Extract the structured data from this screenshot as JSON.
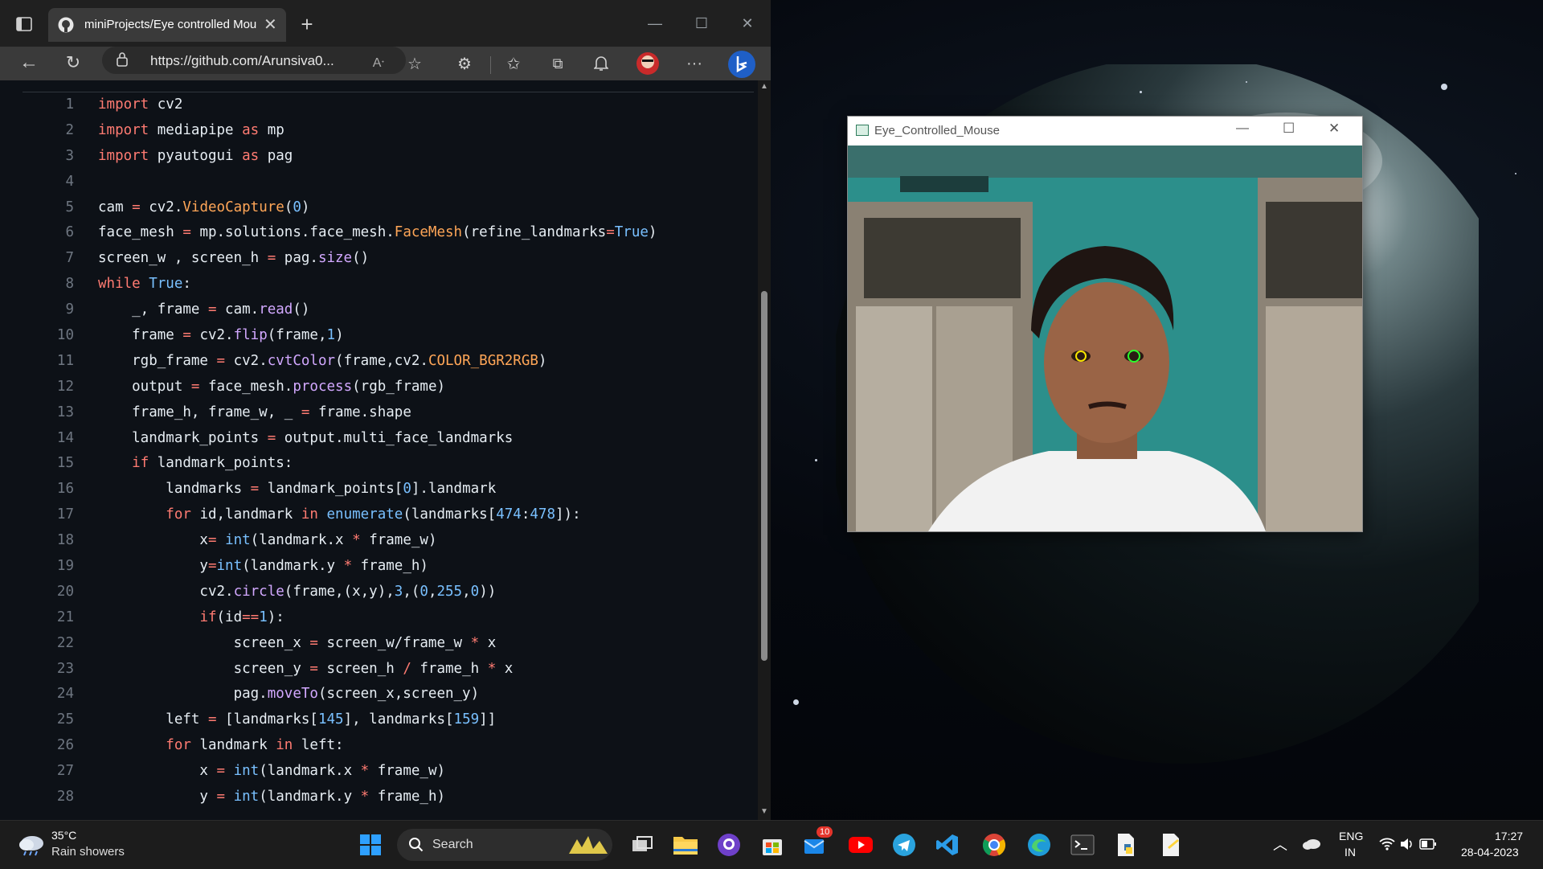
{
  "browser": {
    "tab_title": "miniProjects/Eye controlled Mou",
    "url": "https://github.com/Arunsiva0...",
    "code_lines": [
      {
        "n": "1",
        "html": "<span class='k'>import</span> cv2"
      },
      {
        "n": "2",
        "html": "<span class='k'>import</span> mediapipe <span class='k'>as</span> mp"
      },
      {
        "n": "3",
        "html": "<span class='k'>import</span> pyautogui <span class='k'>as</span> pag"
      },
      {
        "n": "4",
        "html": ""
      },
      {
        "n": "5",
        "html": "cam <span class='k'>=</span> cv2.<span class='c'>VideoCapture</span>(<span class='n'>0</span>)"
      },
      {
        "n": "6",
        "html": "face_mesh <span class='k'>=</span> mp.solutions.face_mesh.<span class='c'>FaceMesh</span>(refine_landmarks<span class='k'>=</span><span class='n'>True</span>)"
      },
      {
        "n": "7",
        "html": "screen_w , screen_h <span class='k'>=</span> pag.<span class='f'>size</span>()"
      },
      {
        "n": "8",
        "html": "<span class='k'>while</span> <span class='n'>True</span>:"
      },
      {
        "n": "9",
        "html": "    _, frame <span class='k'>=</span> cam.<span class='f'>read</span>()"
      },
      {
        "n": "10",
        "html": "    frame <span class='k'>=</span> cv2.<span class='f'>flip</span>(frame,<span class='n'>1</span>)"
      },
      {
        "n": "11",
        "html": "    rgb_frame <span class='k'>=</span> cv2.<span class='f'>cvtColor</span>(frame,cv2.<span class='c'>COLOR_BGR2RGB</span>)"
      },
      {
        "n": "12",
        "html": "    output <span class='k'>=</span> face_mesh.<span class='f'>process</span>(rgb_frame)"
      },
      {
        "n": "13",
        "html": "    frame_h, frame_w, _ <span class='k'>=</span> frame.shape"
      },
      {
        "n": "14",
        "html": "    landmark_points <span class='k'>=</span> output.multi_face_landmarks"
      },
      {
        "n": "15",
        "html": "    <span class='k'>if</span> landmark_points:"
      },
      {
        "n": "16",
        "html": "        landmarks <span class='k'>=</span> landmark_points[<span class='n'>0</span>].landmark"
      },
      {
        "n": "17",
        "html": "        <span class='k'>for</span> id,landmark <span class='k'>in</span> <span class='n'>enumerate</span>(landmarks[<span class='n'>474</span>:<span class='n'>478</span>]):"
      },
      {
        "n": "18",
        "html": "            x<span class='k'>=</span> <span class='n'>int</span>(landmark.x <span class='k'>*</span> frame_w)"
      },
      {
        "n": "19",
        "html": "            y<span class='k'>=</span><span class='n'>int</span>(landmark.y <span class='k'>*</span> frame_h)"
      },
      {
        "n": "20",
        "html": "            cv2.<span class='f'>circle</span>(frame,(x,y),<span class='n'>3</span>,(<span class='n'>0</span>,<span class='n'>255</span>,<span class='n'>0</span>))"
      },
      {
        "n": "21",
        "html": "            <span class='k'>if</span>(id<span class='k'>==</span><span class='n'>1</span>):"
      },
      {
        "n": "22",
        "html": "                screen_x <span class='k'>=</span> screen_w/frame_w <span class='k'>*</span> x"
      },
      {
        "n": "23",
        "html": "                screen_y <span class='k'>=</span> screen_h <span class='k'>/</span> frame_h <span class='k'>*</span> x"
      },
      {
        "n": "24",
        "html": "                pag.<span class='f'>moveTo</span>(screen_x,screen_y)"
      },
      {
        "n": "25",
        "html": "        left <span class='k'>=</span> [landmarks[<span class='n'>145</span>], landmarks[<span class='n'>159</span>]]"
      },
      {
        "n": "26",
        "html": "        <span class='k'>for</span> landmark <span class='k'>in</span> left:"
      },
      {
        "n": "27",
        "html": "            x <span class='k'>=</span> <span class='n'>int</span>(landmark.x <span class='k'>*</span> frame_w)"
      },
      {
        "n": "28",
        "html": "            y <span class='k'>=</span> <span class='n'>int</span>(landmark.y <span class='k'>*</span> frame_h)"
      }
    ]
  },
  "camera_window": {
    "title": "Eye_Controlled_Mouse"
  },
  "taskbar": {
    "weather_temp": "35°C",
    "weather_desc": "Rain showers",
    "search_label": "Search",
    "store_badge": "10",
    "lang_top": "ENG",
    "lang_bottom": "IN",
    "time": "17:27",
    "date": "28-04-2023"
  },
  "colors": {
    "browser_bg": "#202020",
    "code_bg": "#0d1117",
    "keyword": "#ff7b72",
    "function": "#d2a8ff",
    "class": "#ffa657",
    "number": "#79c0ff"
  }
}
